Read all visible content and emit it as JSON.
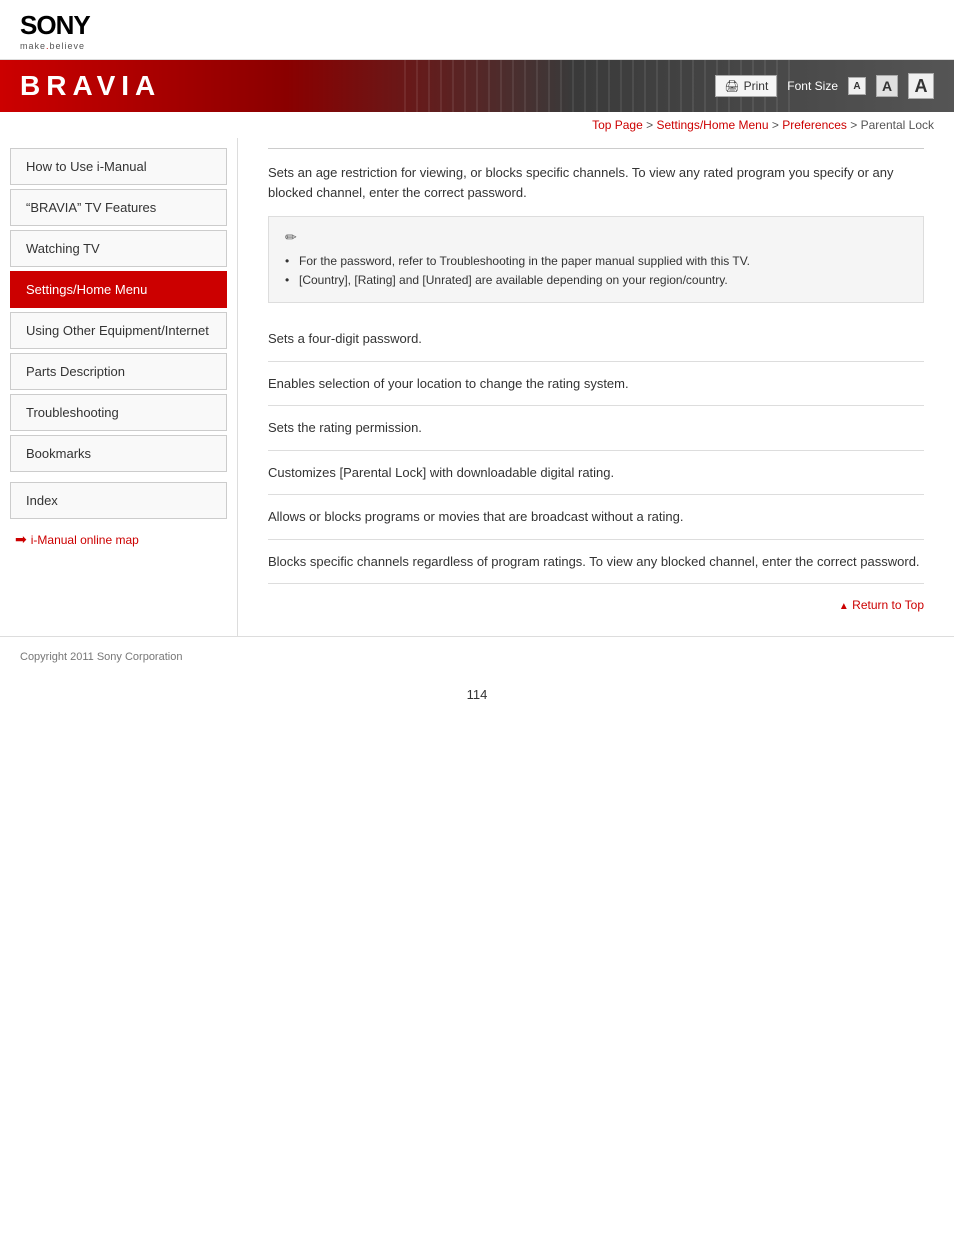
{
  "header": {
    "sony_text": "SONY",
    "make_believe": "make.believe",
    "bravia_title": "BRAVIA",
    "print_label": "Print",
    "font_size_label": "Font Size",
    "font_a_small": "A",
    "font_a_medium": "A",
    "font_a_large": "A"
  },
  "breadcrumb": {
    "top_page": "Top Page",
    "separator1": " > ",
    "settings_home": "Settings/Home Menu",
    "separator2": " > ",
    "preferences": "Preferences",
    "separator3": " > ",
    "current": " Parental Lock"
  },
  "sidebar": {
    "items": [
      {
        "label": "How to Use i-Manual",
        "active": false
      },
      {
        "label": "“BRAVIA” TV Features",
        "active": false
      },
      {
        "label": "Watching TV",
        "active": false
      },
      {
        "label": "Settings/Home Menu",
        "active": true
      },
      {
        "label": "Using Other Equipment/Internet",
        "active": false
      },
      {
        "label": "Parts Description",
        "active": false
      },
      {
        "label": "Troubleshooting",
        "active": false
      },
      {
        "label": "Bookmarks",
        "active": false
      }
    ],
    "index_label": "Index",
    "online_map_label": "i-Manual online map"
  },
  "content": {
    "intro": "Sets an age restriction for viewing, or blocks specific channels. To view any rated program you specify or any blocked channel, enter the correct password.",
    "notes": [
      "For the password, refer to Troubleshooting in the paper manual supplied with this TV.",
      "[Country], [Rating] and [Unrated] are available depending on your region/country."
    ],
    "sections": [
      {
        "text": "Sets a four-digit password."
      },
      {
        "text": "Enables selection of your location to change the rating system."
      },
      {
        "text": "Sets the rating permission."
      },
      {
        "text": "Customizes [Parental Lock] with downloadable digital rating."
      },
      {
        "text": "Allows or blocks programs or movies that are broadcast without a rating."
      },
      {
        "text": "Blocks specific channels regardless of program ratings. To view any blocked channel, enter the correct password."
      }
    ],
    "return_to_top": "Return to Top"
  },
  "footer": {
    "copyright": "Copyright 2011 Sony Corporation",
    "page_number": "114"
  }
}
